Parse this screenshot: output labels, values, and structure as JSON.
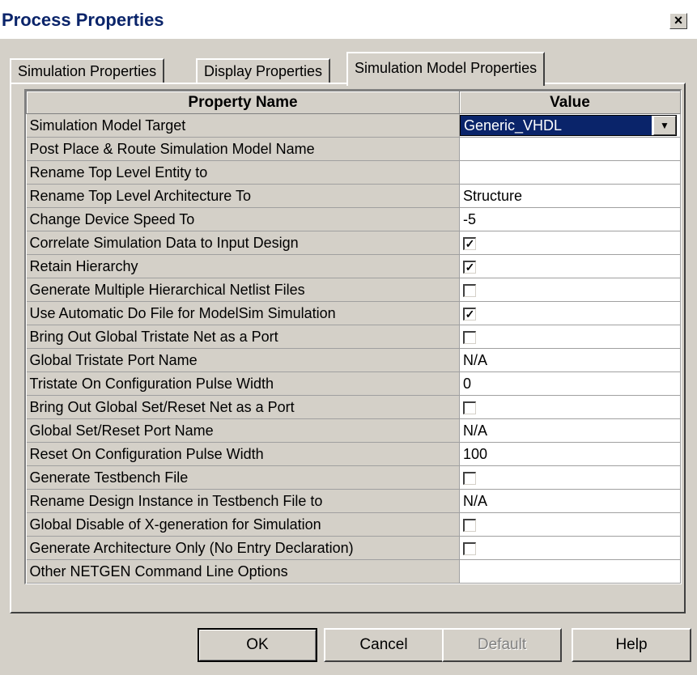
{
  "window": {
    "title": "Process Properties",
    "close_glyph": "×"
  },
  "tabs": [
    {
      "label": "Simulation Properties"
    },
    {
      "label": "Display Properties"
    },
    {
      "label": "Simulation Model Properties"
    }
  ],
  "table": {
    "headers": {
      "name": "Property Name",
      "value": "Value"
    },
    "rows": [
      {
        "name": "Simulation Model Target",
        "type": "combo",
        "value": "Generic_VHDL"
      },
      {
        "name": "Post Place & Route Simulation Model Name",
        "type": "text",
        "value": ""
      },
      {
        "name": "Rename Top Level Entity to",
        "type": "text",
        "value": ""
      },
      {
        "name": "Rename Top Level Architecture To",
        "type": "text",
        "value": "Structure"
      },
      {
        "name": "Change Device Speed To",
        "type": "text",
        "value": "-5"
      },
      {
        "name": "Correlate Simulation Data to Input Design",
        "type": "check",
        "checked": true
      },
      {
        "name": "Retain Hierarchy",
        "type": "check",
        "checked": true
      },
      {
        "name": "Generate Multiple Hierarchical Netlist Files",
        "type": "check",
        "checked": false
      },
      {
        "name": "Use Automatic Do File for ModelSim Simulation",
        "type": "check",
        "checked": true
      },
      {
        "name": "Bring Out Global Tristate Net as a Port",
        "type": "check",
        "checked": false
      },
      {
        "name": "Global Tristate Port Name",
        "type": "text",
        "value": "N/A"
      },
      {
        "name": "Tristate On Configuration Pulse Width",
        "type": "text",
        "value": "0"
      },
      {
        "name": "Bring Out Global Set/Reset Net as a Port",
        "type": "check",
        "checked": false
      },
      {
        "name": "Global Set/Reset Port Name",
        "type": "text",
        "value": "N/A"
      },
      {
        "name": "Reset On Configuration Pulse Width",
        "type": "text",
        "value": "100"
      },
      {
        "name": "Generate Testbench File",
        "type": "check",
        "checked": false
      },
      {
        "name": "Rename Design Instance in Testbench File to",
        "type": "text",
        "value": "N/A"
      },
      {
        "name": "Global Disable of X-generation for Simulation",
        "type": "check",
        "checked": false
      },
      {
        "name": "Generate Architecture Only (No Entry Declaration)",
        "type": "check",
        "checked": false
      },
      {
        "name": "Other NETGEN Command Line Options",
        "type": "text",
        "value": ""
      }
    ]
  },
  "buttons": {
    "ok": "OK",
    "cancel": "Cancel",
    "default": "Default",
    "help": "Help"
  },
  "icons": {
    "dropdown": "▼",
    "check": "✓"
  },
  "colors": {
    "selection": "#0a246a",
    "title_text": "#0a246a",
    "face": "#d4d0c8"
  }
}
